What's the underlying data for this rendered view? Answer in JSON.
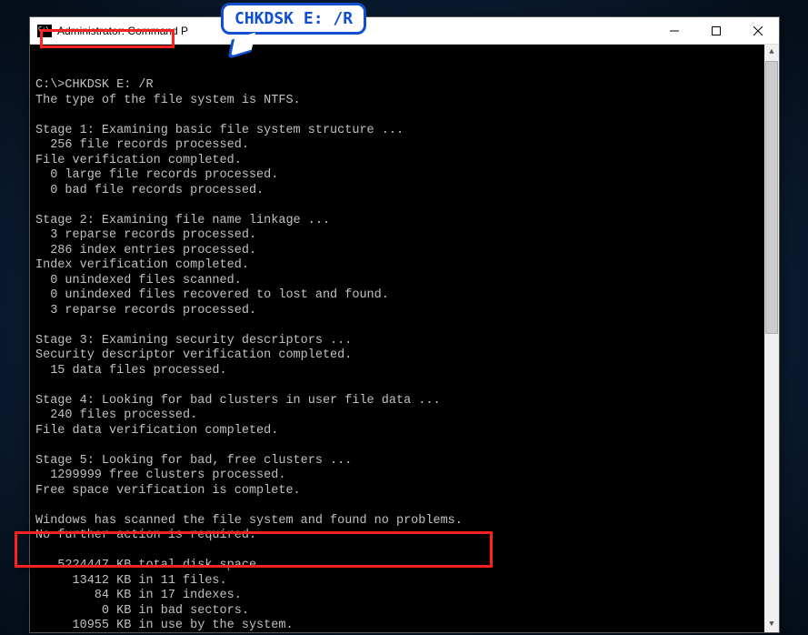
{
  "window": {
    "title": "Administrator: Command P"
  },
  "callout": {
    "text": "CHKDSK E: /R"
  },
  "terminal": {
    "prompt": "C:\\>",
    "command": "CHKDSK E: /R",
    "lines": [
      "",
      "",
      "C:\\>CHKDSK E: /R",
      "The type of the file system is NTFS.",
      "",
      "Stage 1: Examining basic file system structure ...",
      "  256 file records processed.",
      "File verification completed.",
      "  0 large file records processed.",
      "  0 bad file records processed.",
      "",
      "Stage 2: Examining file name linkage ...",
      "  3 reparse records processed.",
      "  286 index entries processed.",
      "Index verification completed.",
      "  0 unindexed files scanned.",
      "  0 unindexed files recovered to lost and found.",
      "  3 reparse records processed.",
      "",
      "Stage 3: Examining security descriptors ...",
      "Security descriptor verification completed.",
      "  15 data files processed.",
      "",
      "Stage 4: Looking for bad clusters in user file data ...",
      "  240 files processed.",
      "File data verification completed.",
      "",
      "Stage 5: Looking for bad, free clusters ...",
      "  1299999 free clusters processed.",
      "Free space verification is complete.",
      "",
      "Windows has scanned the file system and found no problems.",
      "No further action is required.",
      "",
      "   5224447 KB total disk space.",
      "     13412 KB in 11 files.",
      "        84 KB in 17 indexes.",
      "         0 KB in bad sectors.",
      "     10955 KB in use by the system."
    ]
  }
}
